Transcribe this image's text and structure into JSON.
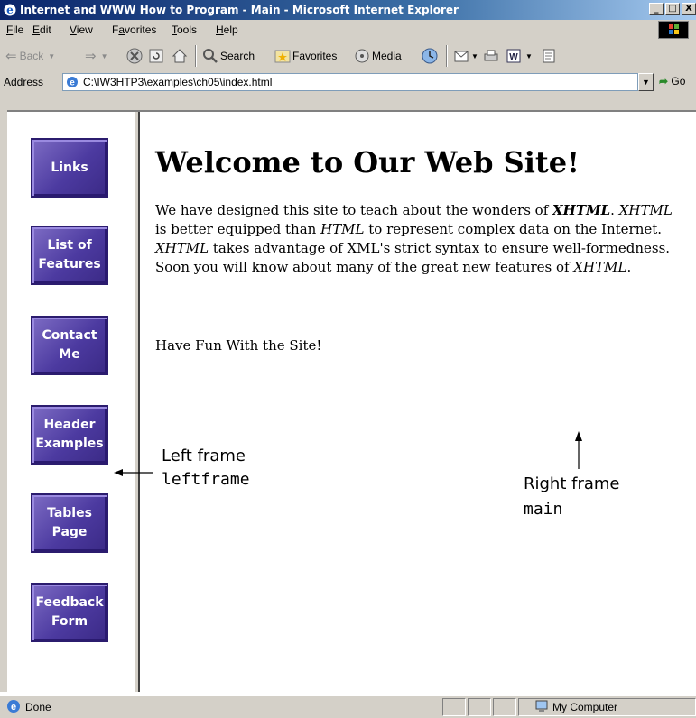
{
  "window": {
    "title": "Internet and WWW How to Program - Main - Microsoft Internet Explorer",
    "controls": [
      "_",
      "□",
      "X"
    ]
  },
  "menubar": {
    "items": [
      "File",
      "Edit",
      "View",
      "Favorites",
      "Tools",
      "Help"
    ],
    "mnemonics": [
      "F",
      "E",
      "V",
      "a",
      "T",
      "H"
    ]
  },
  "toolbar": {
    "back": "Back",
    "search": "Search",
    "favorites": "Favorites",
    "media": "Media"
  },
  "address": {
    "label": "Address",
    "value": "C:\\IW3HTP3\\examples\\ch05\\index.html",
    "go": "Go"
  },
  "left_frame": {
    "buttons": [
      {
        "line1": "Links",
        "line2": ""
      },
      {
        "line1": "List of",
        "line2": "Features"
      },
      {
        "line1": "Contact",
        "line2": "Me"
      },
      {
        "line1": "Header",
        "line2": "Examples"
      },
      {
        "line1": "Tables",
        "line2": "Page"
      },
      {
        "line1": "Feedback",
        "line2": "Form"
      }
    ]
  },
  "main": {
    "heading": "Welcome to Our Web Site!",
    "p1_a": "We have designed this site to teach about the wonders of ",
    "p1_b": "XHTML",
    "p1_c": ". ",
    "p1_d": "XHTML",
    "p1_e": " is better equipped than ",
    "p1_f": "HTML",
    "p1_g": " to represent complex data on the Internet. ",
    "p1_h": "XHTML",
    "p1_i": " takes advantage of XML's strict syntax to ensure well-formedness. Soon you will know about many of the great new features of ",
    "p1_j": "XHTML",
    "p1_k": ".",
    "p2": "Have Fun With the Site!"
  },
  "annotations": {
    "left_label": "Left frame",
    "left_code": "leftframe",
    "right_label": "Right frame",
    "right_code": "main"
  },
  "statusbar": {
    "status": "Done",
    "zone": "My Computer"
  }
}
